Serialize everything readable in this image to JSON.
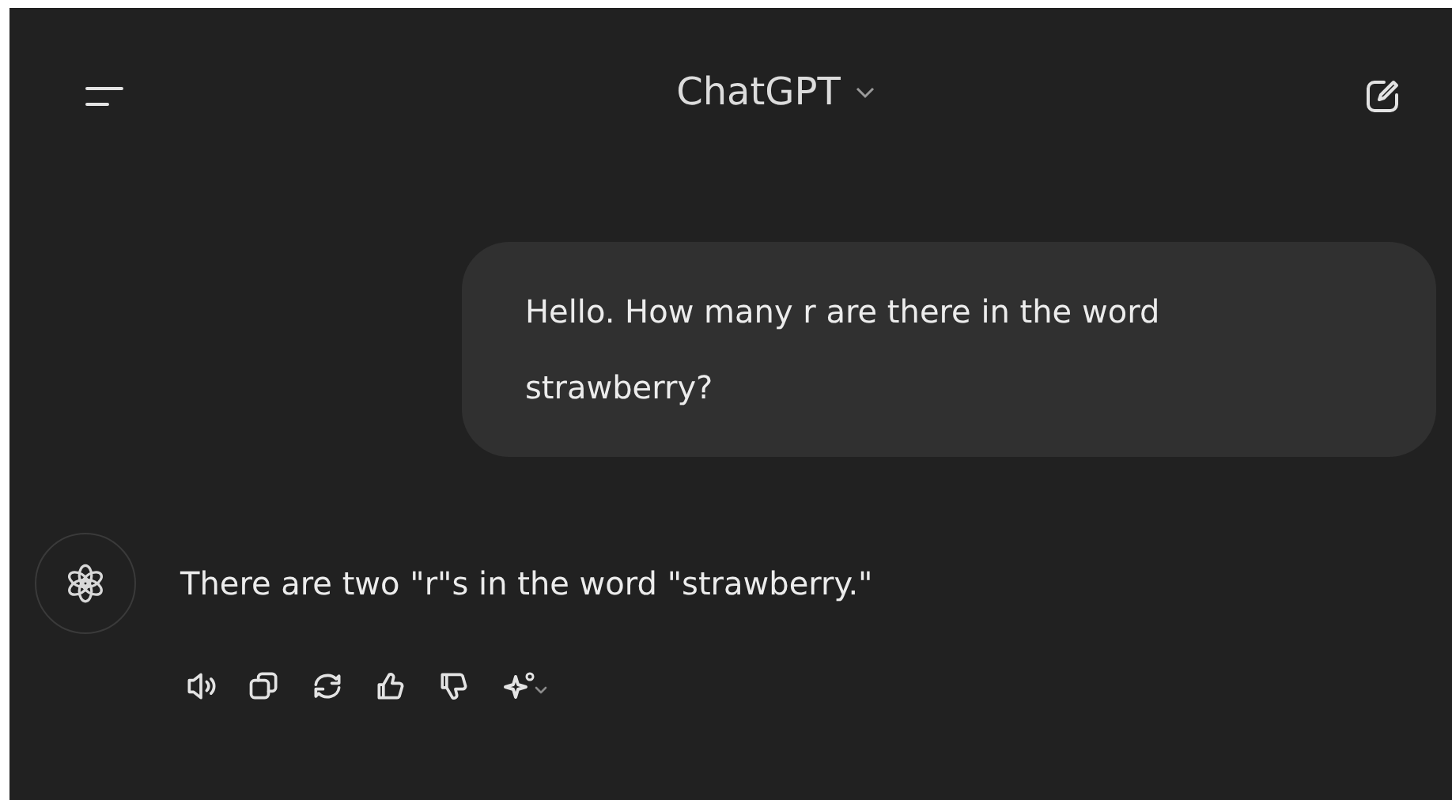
{
  "header": {
    "title": "ChatGPT"
  },
  "messages": [
    {
      "kind": "user",
      "text": "Hello. How many r are there in the word strawberry?"
    },
    {
      "kind": "assistant",
      "text": "There are two \"r\"s in the word \"strawberry.\""
    }
  ]
}
